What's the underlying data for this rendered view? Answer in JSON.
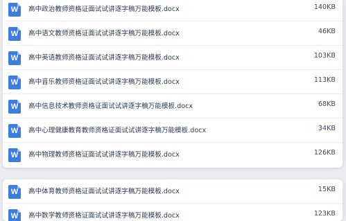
{
  "files_group_1": [
    {
      "name": "高中政治教师资格证面试试讲逐字稿万能模板.docx",
      "size": "140KB",
      "icon": "word-document-icon"
    },
    {
      "name": "高中语文教师资格证面试试讲逐字稿万能模板.docx",
      "size": "46KB",
      "icon": "word-document-icon"
    },
    {
      "name": "高中英语教师资格证面试试讲逐字稿万能模板.docx",
      "size": "103KB",
      "icon": "word-document-icon"
    },
    {
      "name": "高中音乐教师资格证面试试讲逐字稿万能模板.docx",
      "size": "113KB",
      "icon": "word-document-icon"
    },
    {
      "name": "高中信息技术教师资格证面试试讲逐字稿万能模板.docx",
      "size": "68KB",
      "icon": "word-document-icon"
    },
    {
      "name": "高中心理健康教育教师资格证面试试讲逐字稿万能模板.docx",
      "size": "34KB",
      "icon": "word-document-icon"
    },
    {
      "name": "高中物理教师资格证面试试讲逐字稿万能模板.docx",
      "size": "126KB",
      "icon": "word-document-icon"
    }
  ],
  "files_group_2": [
    {
      "name": "高中体育教师资格证面试试讲逐字稿万能模板.docx",
      "size": "15KB",
      "icon": "word-document-icon"
    },
    {
      "name": "高中数学教师资格证面试试讲逐字稿万能模板.docx",
      "size": "123KB",
      "icon": "word-document-icon"
    }
  ],
  "icon_letter": "W",
  "colors": {
    "icon_blue": "#3e7de0",
    "text": "#2b3a4f",
    "background": "#e9ebef"
  }
}
